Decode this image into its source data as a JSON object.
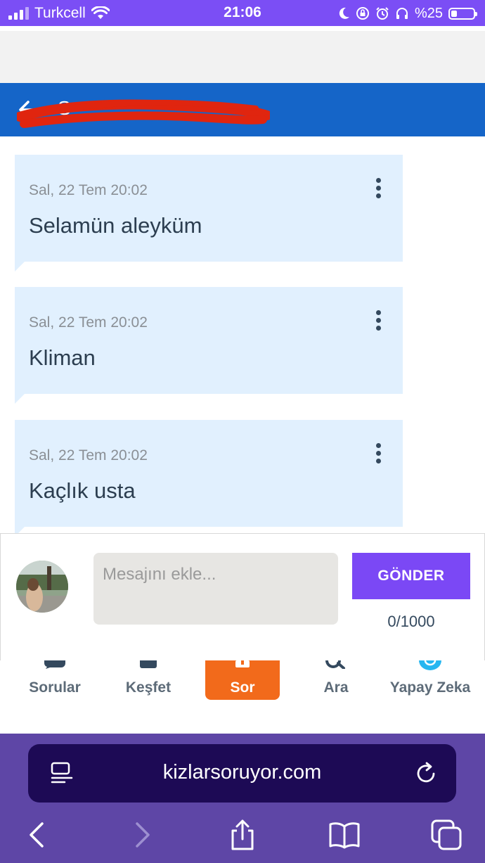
{
  "status_bar": {
    "carrier": "Turkcell",
    "time": "21:06",
    "battery_text": "%25",
    "battery_level": 0.25
  },
  "header": {
    "title": "S"
  },
  "messages": [
    {
      "date": "Sal, 22 Tem 20:02",
      "text": "Selamün aleyküm"
    },
    {
      "date": "Sal, 22 Tem 20:02",
      "text": "Kliman"
    },
    {
      "date": "Sal, 22 Tem 20:02",
      "text": "Kaçlık usta"
    }
  ],
  "composer": {
    "placeholder": "Mesajını ekle...",
    "value": "",
    "send_label": "GÖNDER",
    "counter": "0/1000"
  },
  "nav": {
    "items": [
      {
        "label": "Sorular",
        "icon": "chat-bubble-icon"
      },
      {
        "label": "Keşfet",
        "icon": "stack-icon"
      },
      {
        "label": "Sor",
        "icon": "plus-icon"
      },
      {
        "label": "Ara",
        "icon": "search-icon"
      },
      {
        "label": "Yapay Zeka",
        "icon": "ai-icon"
      }
    ]
  },
  "browser": {
    "url": "kizlarsoruyor.com"
  },
  "colors": {
    "status_bar": "#7b4ef5",
    "header": "#1565c8",
    "message_bg": "#e1f0fe",
    "send_button": "#7b48f5",
    "ask_button": "#f26a1b",
    "browser_bar": "#5e46a6",
    "url_field": "#1d0a55"
  }
}
